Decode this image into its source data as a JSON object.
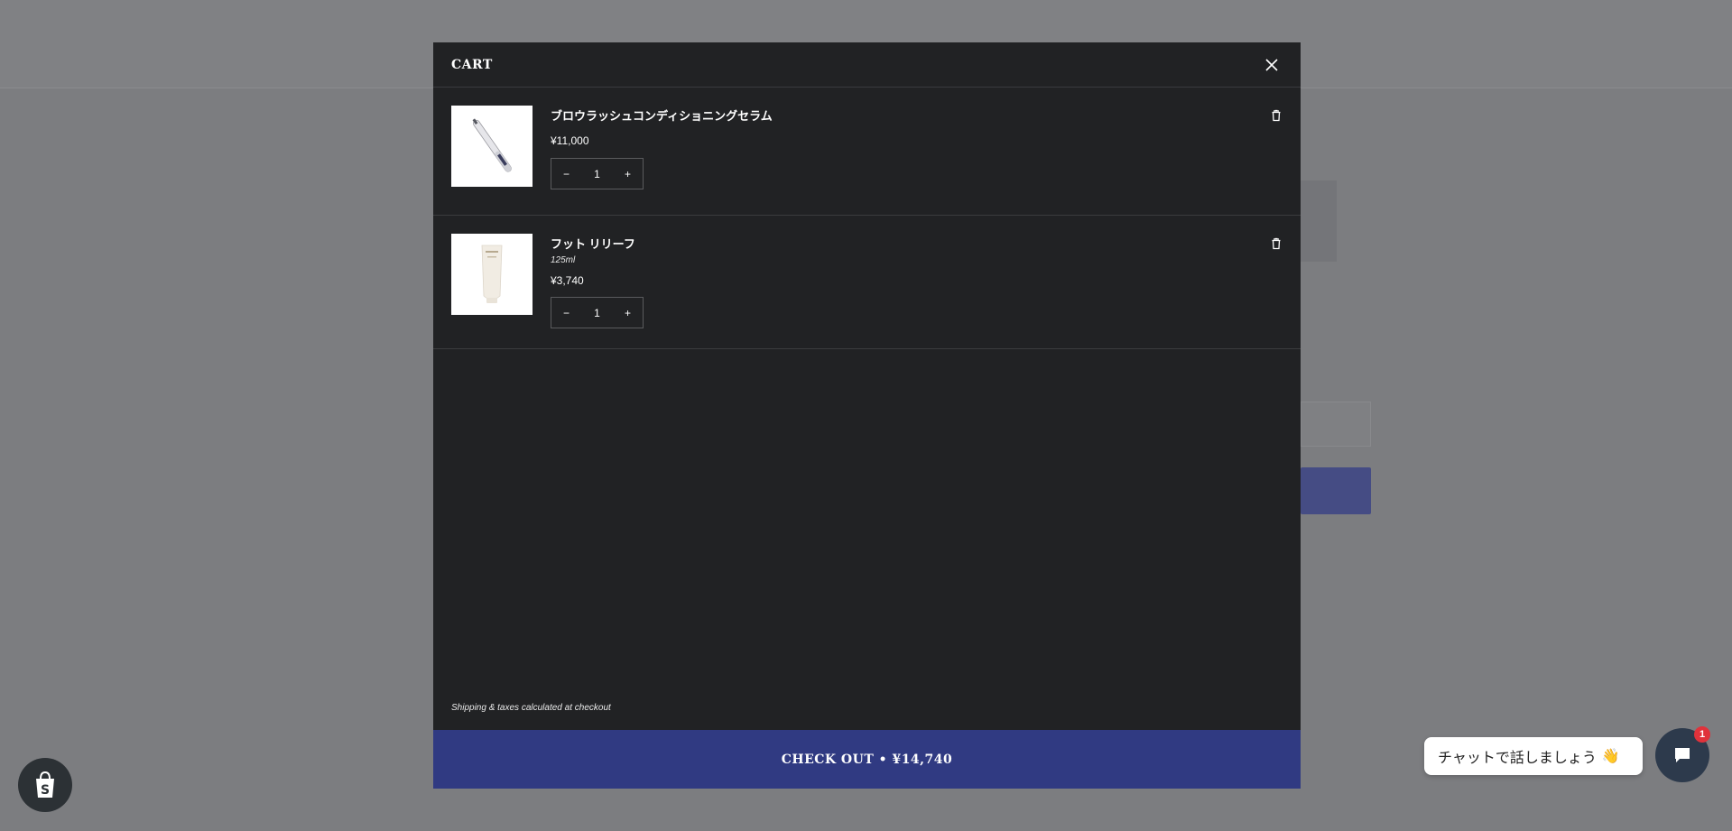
{
  "cart": {
    "title": "CART",
    "items": [
      {
        "title": "ブロウラッシュコンディショニングセラム",
        "variant": "",
        "price": "¥11,000",
        "quantity": "1",
        "image_icon": "serum-pen-product-image"
      },
      {
        "title": "フット リリーフ",
        "variant": "125ml",
        "price": "¥3,740",
        "quantity": "1",
        "image_icon": "cream-tube-product-image"
      }
    ],
    "qty_minus": "−",
    "qty_plus": "+",
    "shipping_note": "Shipping & taxes calculated at checkout",
    "checkout_label": "CHECK OUT • ¥14,740"
  },
  "chat": {
    "prompt": "チャットで話しましょう",
    "wave_emoji": "👋",
    "badge_count": "1"
  },
  "colors": {
    "modal_bg": "#212224",
    "checkout_bg": "#303a82",
    "overlay_bg": "#7c7d80",
    "chat_launcher": "#2d3a4c",
    "badge": "#e0323b"
  }
}
